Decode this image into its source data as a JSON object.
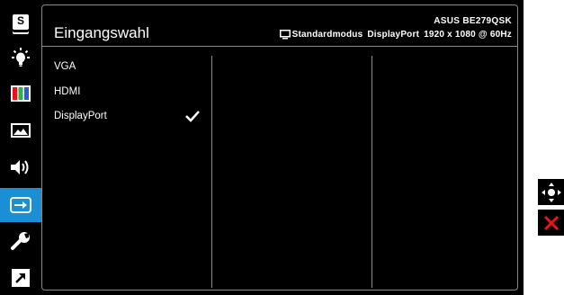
{
  "sidebar": {
    "items": [
      {
        "icon": "splendid-s-icon",
        "label": "S"
      },
      {
        "icon": "bluelight-filter-icon"
      },
      {
        "icon": "color-bars-icon"
      },
      {
        "icon": "image-icon"
      },
      {
        "icon": "speaker-icon"
      },
      {
        "icon": "input-select-icon",
        "active": true
      },
      {
        "icon": "wrench-icon"
      },
      {
        "icon": "shortcut-icon"
      }
    ]
  },
  "header": {
    "title": "Eingangswahl",
    "model": "ASUS BE279QSK",
    "mode": "Standardmodus",
    "input": "DisplayPort",
    "resolution": "1920 x 1080 @ 60Hz"
  },
  "options": [
    {
      "label": "VGA",
      "selected": false
    },
    {
      "label": "HDMI",
      "selected": false
    },
    {
      "label": "DisplayPort",
      "selected": true
    }
  ],
  "nav": {
    "move_icon": "joystick-move-icon",
    "close_icon": "close-x-icon"
  },
  "colors": {
    "background": "#000000",
    "accent": "#1a8fd6",
    "divider": "#8a8a8a",
    "close": "#e8131e"
  }
}
